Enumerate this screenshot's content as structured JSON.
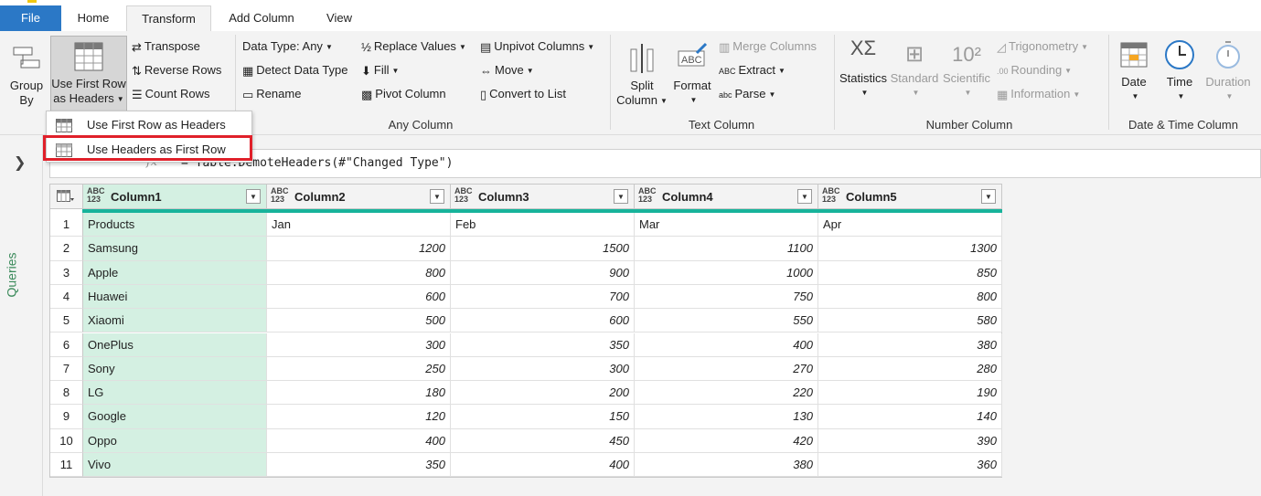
{
  "tabs": [
    "File",
    "Home",
    "Transform",
    "Add Column",
    "View"
  ],
  "ribbon": {
    "table": {
      "group_by": [
        "Group",
        "By"
      ],
      "use_first_row": [
        "Use First Row",
        "as Headers"
      ],
      "transpose": "Transpose",
      "reverse_rows": "Reverse Rows",
      "count_rows": "Count Rows"
    },
    "any_column": {
      "data_type": "Data Type: Any",
      "detect_data_type": "Detect Data Type",
      "rename": "Rename",
      "replace_values": "Replace Values",
      "fill": "Fill",
      "pivot_column": "Pivot Column",
      "unpivot_columns": "Unpivot Columns",
      "move": "Move",
      "convert_to_list": "Convert to List",
      "label": "Any Column"
    },
    "text_column": {
      "split_column": [
        "Split",
        "Column"
      ],
      "format": "Format",
      "merge_columns": "Merge Columns",
      "extract": "Extract",
      "parse": "Parse",
      "label": "Text Column"
    },
    "number_column": {
      "statistics": "Statistics",
      "standard": "Standard",
      "scientific": "Scientific",
      "trigonometry": "Trigonometry",
      "rounding": "Rounding",
      "information": "Information",
      "label": "Number Column"
    },
    "datetime_column": {
      "date": "Date",
      "time": "Time",
      "duration": "Duration",
      "label": "Date & Time Column"
    }
  },
  "dropdown": {
    "items": [
      "Use First Row as Headers",
      "Use Headers as First Row"
    ]
  },
  "left_pane": {
    "queries_label": "Queries"
  },
  "formula_bar": {
    "text": "= Table.DemoteHeaders(#\"Changed Type\")"
  },
  "table": {
    "type_label": "ABC\n123",
    "columns": [
      "Column1",
      "Column2",
      "Column3",
      "Column4",
      "Column5"
    ],
    "rows": [
      [
        "1",
        "Products",
        "Jan",
        "Feb",
        "Mar",
        "Apr"
      ],
      [
        "2",
        "Samsung",
        "1200",
        "1500",
        "1100",
        "1300"
      ],
      [
        "3",
        "Apple",
        "800",
        "900",
        "1000",
        "850"
      ],
      [
        "4",
        "Huawei",
        "600",
        "700",
        "750",
        "800"
      ],
      [
        "5",
        "Xiaomi",
        "500",
        "600",
        "550",
        "580"
      ],
      [
        "6",
        "OnePlus",
        "300",
        "350",
        "400",
        "380"
      ],
      [
        "7",
        "Sony",
        "250",
        "300",
        "270",
        "280"
      ],
      [
        "8",
        "LG",
        "180",
        "200",
        "220",
        "190"
      ],
      [
        "9",
        "Google",
        "120",
        "150",
        "130",
        "140"
      ],
      [
        "10",
        "Oppo",
        "400",
        "450",
        "420",
        "390"
      ],
      [
        "11",
        "Vivo",
        "350",
        "400",
        "380",
        "360"
      ]
    ]
  },
  "colors": {
    "file_tab": "#2b78c6",
    "highlight_box": "#e0202a",
    "selected_column": "#d4f0e2",
    "column_accent": "#17b39b"
  }
}
